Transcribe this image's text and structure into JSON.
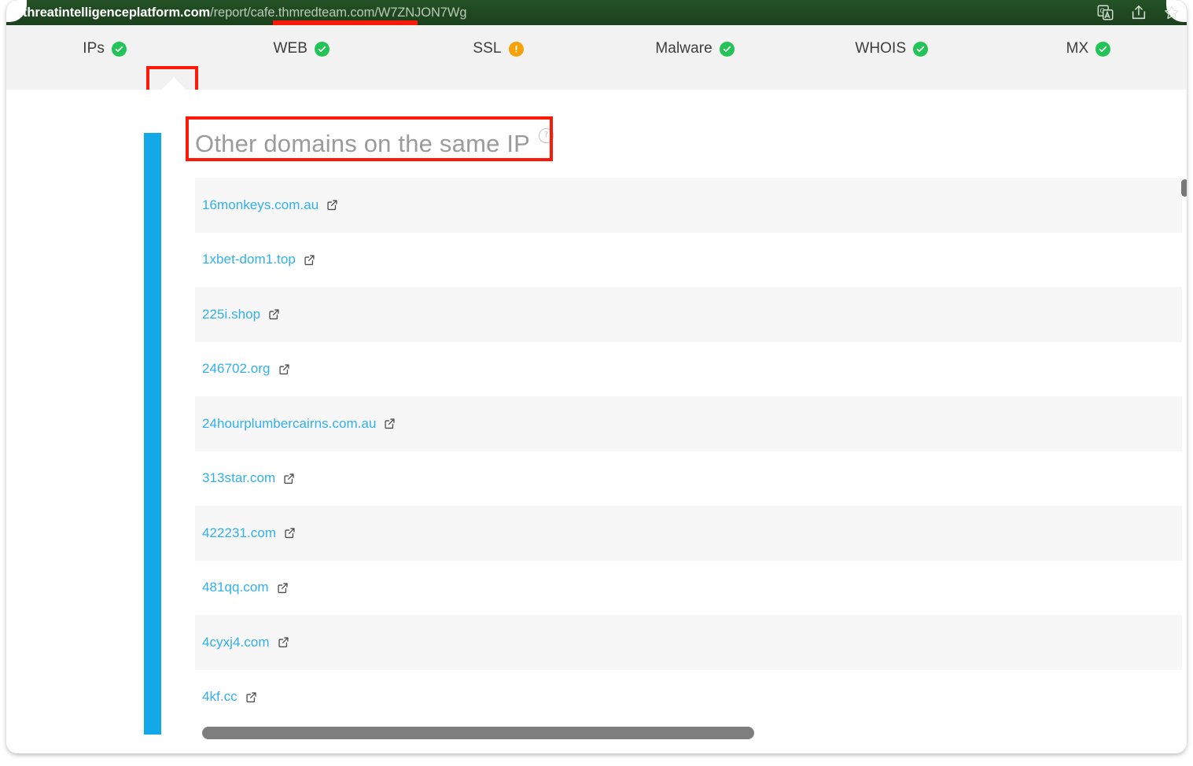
{
  "browser": {
    "url": {
      "host": "threatintelligenceplatform.com",
      "path": "/report/cafe.thmredteam.com/W7ZNJON7Wg",
      "highlighted_segment": "cafe.thmredteam.com"
    },
    "toolbar_icons": [
      {
        "name": "translate-icon",
        "title": "Translate this page"
      },
      {
        "name": "share-icon",
        "title": "Share"
      },
      {
        "name": "favorite-star-icon",
        "title": "Add to favorites"
      }
    ]
  },
  "tabs": [
    {
      "label": "IPs",
      "status": "ok",
      "active": true
    },
    {
      "label": "WEB",
      "status": "ok",
      "active": false
    },
    {
      "label": "SSL",
      "status": "warn",
      "active": false
    },
    {
      "label": "Malware",
      "status": "ok",
      "active": false
    },
    {
      "label": "WHOIS",
      "status": "ok",
      "active": false
    },
    {
      "label": "MX",
      "status": "ok",
      "active": false
    }
  ],
  "panel": {
    "title": "Other domains on the same IP",
    "help_tooltip": "?"
  },
  "domains": [
    {
      "name": "16monkeys.com.au"
    },
    {
      "name": "1xbet-dom1.top"
    },
    {
      "name": "225i.shop"
    },
    {
      "name": "246702.org"
    },
    {
      "name": "24hourplumbercairns.com.au"
    },
    {
      "name": "313star.com"
    },
    {
      "name": "422231.com"
    },
    {
      "name": "481qq.com"
    },
    {
      "name": "4cyxj4.com"
    },
    {
      "name": "4kf.cc"
    }
  ],
  "colors": {
    "urlbar_green": "#1d4620",
    "accent_blue": "#13a8e8",
    "link_blue": "#31b0ed",
    "annotation_red": "#fa1a07",
    "status_ok_green": "#22c458",
    "status_warn_orange": "#f5a209",
    "row_alt_gray": "#f7f7f7",
    "tabstrip_gray": "#f2f2f2"
  }
}
